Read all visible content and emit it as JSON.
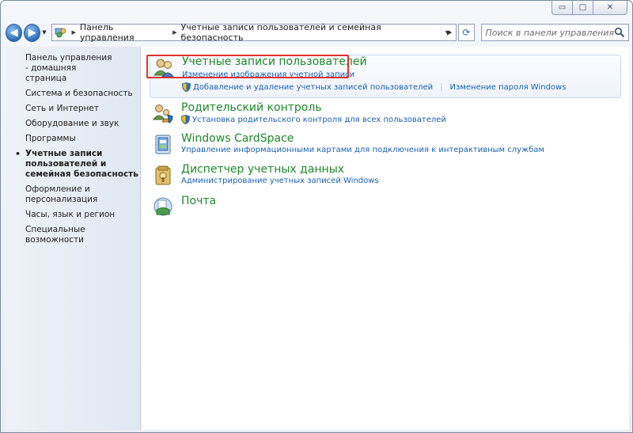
{
  "window": {
    "caption": {
      "minimize_glyph": "▭",
      "maximize_glyph": "□",
      "close_glyph": "✕"
    }
  },
  "toolbar": {
    "back_glyph": "◀",
    "forward_glyph": "▶",
    "history_glyph": "▼",
    "breadcrumb": [
      "Панель управления",
      "Учетные записи пользователей и семейная безопасность"
    ],
    "crumb_sep": "▶",
    "address_drop_glyph": "▼",
    "refresh_glyph": "⟳",
    "search_placeholder": "Поиск в панели управления"
  },
  "sidebar": {
    "items": [
      {
        "label": "Панель управления - домашняя страница",
        "active": false
      },
      {
        "label": "Система и безопасность",
        "active": false
      },
      {
        "label": "Сеть и Интернет",
        "active": false
      },
      {
        "label": "Оборудование и звук",
        "active": false
      },
      {
        "label": "Программы",
        "active": false
      },
      {
        "label": "Учетные записи пользователей и семейная безопасность",
        "active": true
      },
      {
        "label": "Оформление и персонализация",
        "active": false
      },
      {
        "label": "Часы, язык и регион",
        "active": false
      },
      {
        "label": "Специальные возможности",
        "active": false
      }
    ]
  },
  "categories": [
    {
      "title": "Учетные записи пользователей",
      "icon": "users-icon",
      "links": [
        "Изменение изображения учетной записи"
      ],
      "shield_links": [
        "Добавление и удаление учетных записей пользователей"
      ],
      "extra_link": "Изменение пароля Windows"
    },
    {
      "title": "Родительский контроль",
      "icon": "parental-control-icon",
      "shield_links": [
        "Установка родительского контроля для всех пользователей"
      ]
    },
    {
      "title": "Windows CardSpace",
      "icon": "cardspace-icon",
      "links": [
        "Управление информационными картами для подключения к интерактивным службам"
      ]
    },
    {
      "title": "Диспетчер учетных данных",
      "icon": "credential-manager-icon",
      "links": [
        "Администрирование учетных записей Windows"
      ]
    },
    {
      "title": "Почта",
      "icon": "mail-icon"
    }
  ],
  "colors": {
    "category_title": "#1d8a2a",
    "link": "#1a5fb4",
    "highlight_border": "#e0322b"
  }
}
